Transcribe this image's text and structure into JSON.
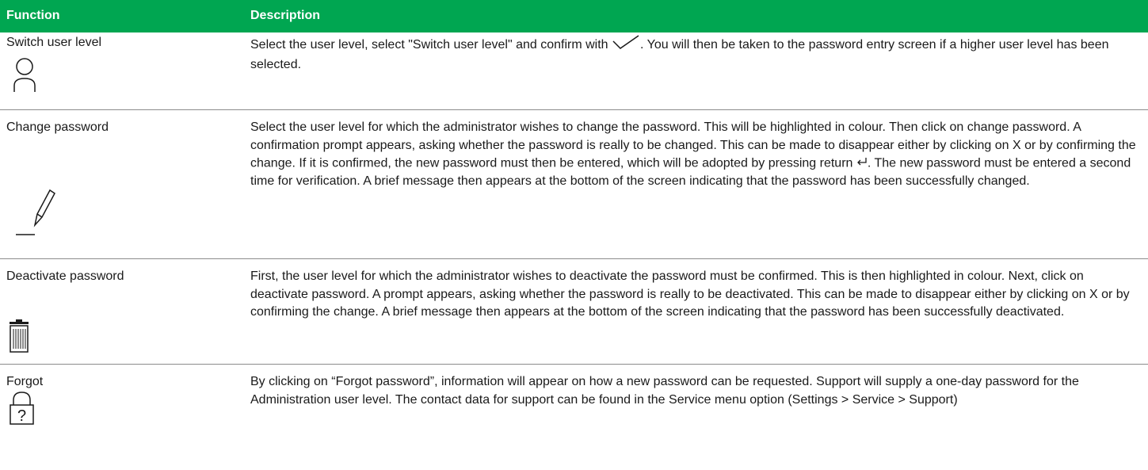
{
  "table": {
    "headers": {
      "function": "Function",
      "description": "Description"
    },
    "rows": [
      {
        "function": "Switch user level",
        "icon": "user-icon",
        "description_pre": "Select the user level, select \"Switch user level\" and confirm with",
        "description_post": ". You will then be taken to the password entry screen if a higher user level has been selected.",
        "inline_icon": "check-icon"
      },
      {
        "function": "Change password",
        "icon": "pencil-icon",
        "description_pre": "Select the user level for which the administrator wishes to change the password. This will be highlighted in colour. Then click on change password. A confirmation prompt appears, asking whether the password is really to be changed. This can be made to disappear either by clicking on X or by confirming the change. If it is confirmed, the new password must then be entered, which will be adopted by pressing return",
        "description_post": ". The new password must be entered a second time for verification. A brief message then appears at the bottom of the screen indicating that the password has been successfully changed.",
        "inline_icon": "return-icon"
      },
      {
        "function": "Deactivate password",
        "icon": "trash-icon",
        "description": "First, the user level for which the administrator wishes to deactivate the password must be confirmed. This is then highlighted in colour. Next, click on deactivate password. A prompt appears, asking whether the password is really to be deactivated. This can be made to disappear either by clicking on X or by confirming the change. A brief message then appears at the bottom of the screen indicating that the password has been successfully deactivated."
      },
      {
        "function": "Forgot",
        "icon": "lock-question-icon",
        "description": "By clicking on “Forgot password”, information will appear on how a new password can be requested. Support will supply a one-day password for the Administration user level. The contact data for support can be found in the Service menu option (Settings > Service > Support)"
      }
    ]
  },
  "colors": {
    "header_bg": "#00a651",
    "header_text": "#ffffff",
    "divider": "#8c8c8c"
  }
}
